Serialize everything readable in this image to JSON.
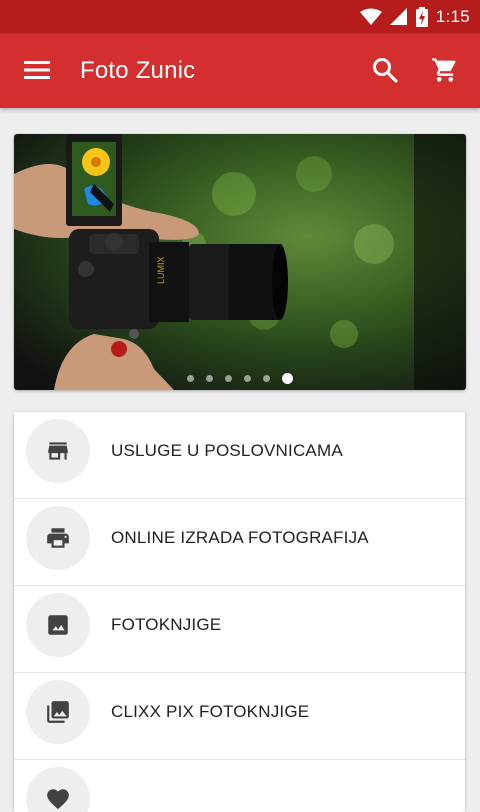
{
  "status_bar": {
    "time": "1:15",
    "icons": [
      "wifi-icon",
      "signal-icon",
      "battery-charging-icon"
    ]
  },
  "app_bar": {
    "title": "Foto Zunic",
    "icons": [
      "menu-icon",
      "search-icon",
      "cart-icon"
    ]
  },
  "banner": {
    "slide_count": 6,
    "active_slide": 6
  },
  "menu": {
    "items": [
      {
        "label": "USLUGE U POSLOVNICAMA",
        "icon": "store-icon"
      },
      {
        "label": "ONLINE IZRADA FOTOGRAFIJA",
        "icon": "printer-icon"
      },
      {
        "label": "FOTOKNJIGE",
        "icon": "photo-book-icon"
      },
      {
        "label": "CLIXX PIX FOTOKNJIGE",
        "icon": "photo-library-icon"
      },
      {
        "label": "",
        "icon": "heart-icon"
      }
    ]
  },
  "colors": {
    "primary": "#d32f2f",
    "primary_dark": "#b71c1c",
    "icon_gray": "#424242"
  }
}
